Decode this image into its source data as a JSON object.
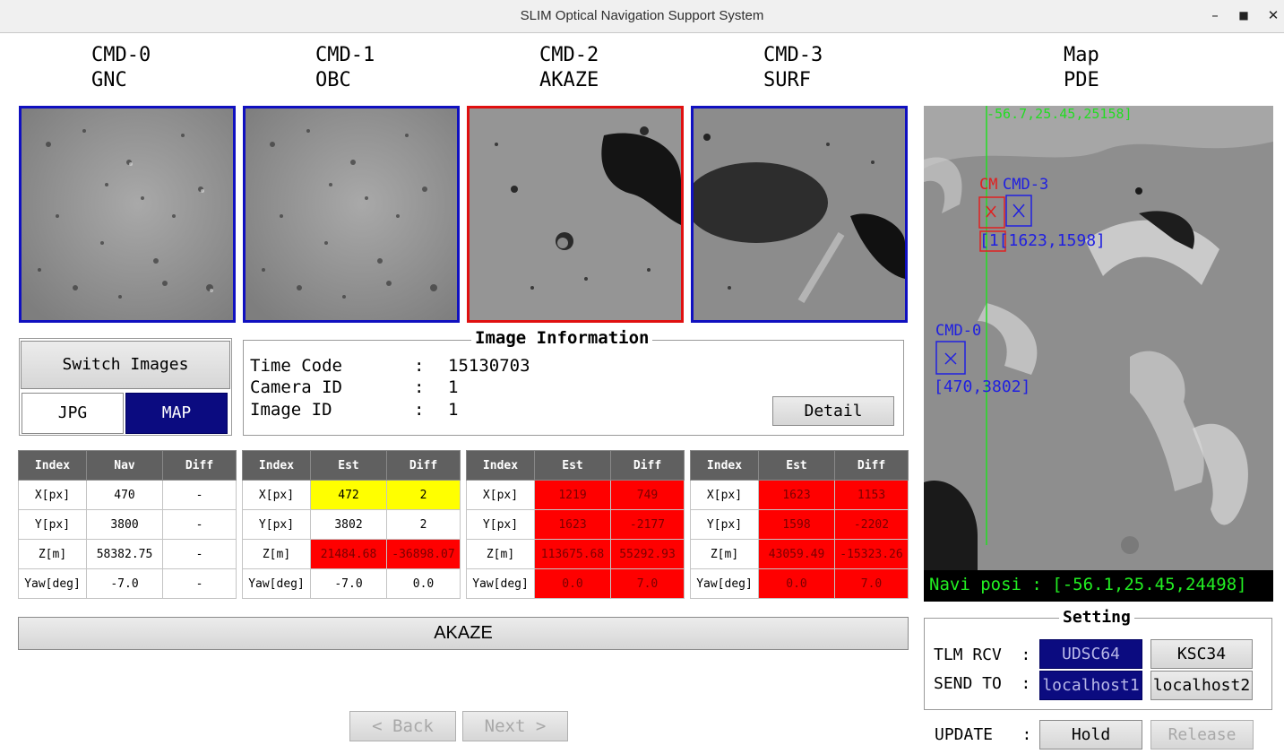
{
  "window": {
    "title": "SLIM Optical Navigation Support System"
  },
  "columns": [
    {
      "cmd": "CMD-0",
      "name": "GNC"
    },
    {
      "cmd": "CMD-1",
      "name": "OBC"
    },
    {
      "cmd": "CMD-2",
      "name": "AKAZE"
    },
    {
      "cmd": "CMD-3",
      "name": "SURF"
    },
    {
      "cmd": "Map",
      "name": "PDE"
    }
  ],
  "image_controls": {
    "switch_label": "Switch Images",
    "jpg_label": "JPG",
    "map_label": "MAP"
  },
  "image_info": {
    "title": "Image Information",
    "rows": [
      {
        "label": "Time Code",
        "value": "15130703"
      },
      {
        "label": "Camera ID",
        "value": "1"
      },
      {
        "label": "Image ID",
        "value": "1"
      }
    ],
    "detail_label": "Detail"
  },
  "tables": [
    {
      "headers": [
        "Index",
        "Nav",
        "Diff"
      ],
      "rows": [
        [
          "X[px]",
          "470",
          "-"
        ],
        [
          "Y[px]",
          "3800",
          "-"
        ],
        [
          "Z[m]",
          "58382.75",
          "-"
        ],
        [
          "Yaw[deg]",
          "-7.0",
          "-"
        ]
      ]
    },
    {
      "headers": [
        "Index",
        "Est",
        "Diff"
      ],
      "rows": [
        [
          "X[px]",
          "472",
          "2"
        ],
        [
          "Y[px]",
          "3802",
          "2"
        ],
        [
          "Z[m]",
          "21484.68",
          "-36898.07"
        ],
        [
          "Yaw[deg]",
          "-7.0",
          "0.0"
        ]
      ]
    },
    {
      "headers": [
        "Index",
        "Est",
        "Diff"
      ],
      "rows": [
        [
          "X[px]",
          "1219",
          "749"
        ],
        [
          "Y[px]",
          "1623",
          "-2177"
        ],
        [
          "Z[m]",
          "113675.68",
          "55292.93"
        ],
        [
          "Yaw[deg]",
          "0.0",
          "7.0"
        ]
      ]
    },
    {
      "headers": [
        "Index",
        "Est",
        "Diff"
      ],
      "rows": [
        [
          "X[px]",
          "1623",
          "1153"
        ],
        [
          "Y[px]",
          "1598",
          "-2202"
        ],
        [
          "Z[m]",
          "43059.49",
          "-15323.26"
        ],
        [
          "Yaw[deg]",
          "0.0",
          "7.0"
        ]
      ]
    }
  ],
  "selected_method": "AKAZE",
  "nav_buttons": {
    "back": "< Back",
    "next": "Next >"
  },
  "map": {
    "top_label": "-56.7,25.45,25158]",
    "cmd2_label": "CM",
    "cmd3_label": "CMD-3",
    "cmd23_coords_label": "[1[1623,1598]",
    "cmd0_label": "CMD-0",
    "cmd0_coords_label": "[470,3802]",
    "navi_posi": "Navi posi : [-56.1,25.45,24498]"
  },
  "setting": {
    "title": "Setting",
    "tlm_label": "TLM RCV  :",
    "send_label": "SEND TO  :",
    "tlm_options": [
      "UDSC64",
      "KSC34"
    ],
    "send_options": [
      "localhost1",
      "localhost2"
    ],
    "update_label": "UPDATE   :",
    "hold_label": "Hold",
    "release_label": "Release"
  },
  "colors": {
    "frame_blue": "#1010c0",
    "frame_red": "#e01010",
    "selected": "#0b0b80",
    "highlight_yellow": "#ffff00",
    "highlight_red": "#ff0000"
  }
}
